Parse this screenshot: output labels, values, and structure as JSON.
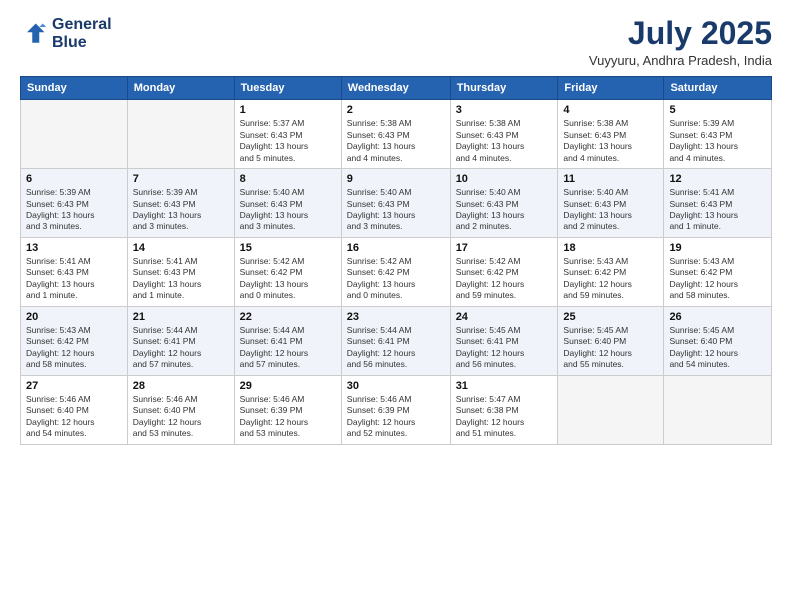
{
  "logo": {
    "line1": "General",
    "line2": "Blue"
  },
  "title": "July 2025",
  "location": "Vuyyuru, Andhra Pradesh, India",
  "weekdays": [
    "Sunday",
    "Monday",
    "Tuesday",
    "Wednesday",
    "Thursday",
    "Friday",
    "Saturday"
  ],
  "weeks": [
    [
      {
        "day": "",
        "info": ""
      },
      {
        "day": "",
        "info": ""
      },
      {
        "day": "1",
        "info": "Sunrise: 5:37 AM\nSunset: 6:43 PM\nDaylight: 13 hours\nand 5 minutes."
      },
      {
        "day": "2",
        "info": "Sunrise: 5:38 AM\nSunset: 6:43 PM\nDaylight: 13 hours\nand 4 minutes."
      },
      {
        "day": "3",
        "info": "Sunrise: 5:38 AM\nSunset: 6:43 PM\nDaylight: 13 hours\nand 4 minutes."
      },
      {
        "day": "4",
        "info": "Sunrise: 5:38 AM\nSunset: 6:43 PM\nDaylight: 13 hours\nand 4 minutes."
      },
      {
        "day": "5",
        "info": "Sunrise: 5:39 AM\nSunset: 6:43 PM\nDaylight: 13 hours\nand 4 minutes."
      }
    ],
    [
      {
        "day": "6",
        "info": "Sunrise: 5:39 AM\nSunset: 6:43 PM\nDaylight: 13 hours\nand 3 minutes."
      },
      {
        "day": "7",
        "info": "Sunrise: 5:39 AM\nSunset: 6:43 PM\nDaylight: 13 hours\nand 3 minutes."
      },
      {
        "day": "8",
        "info": "Sunrise: 5:40 AM\nSunset: 6:43 PM\nDaylight: 13 hours\nand 3 minutes."
      },
      {
        "day": "9",
        "info": "Sunrise: 5:40 AM\nSunset: 6:43 PM\nDaylight: 13 hours\nand 3 minutes."
      },
      {
        "day": "10",
        "info": "Sunrise: 5:40 AM\nSunset: 6:43 PM\nDaylight: 13 hours\nand 2 minutes."
      },
      {
        "day": "11",
        "info": "Sunrise: 5:40 AM\nSunset: 6:43 PM\nDaylight: 13 hours\nand 2 minutes."
      },
      {
        "day": "12",
        "info": "Sunrise: 5:41 AM\nSunset: 6:43 PM\nDaylight: 13 hours\nand 1 minute."
      }
    ],
    [
      {
        "day": "13",
        "info": "Sunrise: 5:41 AM\nSunset: 6:43 PM\nDaylight: 13 hours\nand 1 minute."
      },
      {
        "day": "14",
        "info": "Sunrise: 5:41 AM\nSunset: 6:43 PM\nDaylight: 13 hours\nand 1 minute."
      },
      {
        "day": "15",
        "info": "Sunrise: 5:42 AM\nSunset: 6:42 PM\nDaylight: 13 hours\nand 0 minutes."
      },
      {
        "day": "16",
        "info": "Sunrise: 5:42 AM\nSunset: 6:42 PM\nDaylight: 13 hours\nand 0 minutes."
      },
      {
        "day": "17",
        "info": "Sunrise: 5:42 AM\nSunset: 6:42 PM\nDaylight: 12 hours\nand 59 minutes."
      },
      {
        "day": "18",
        "info": "Sunrise: 5:43 AM\nSunset: 6:42 PM\nDaylight: 12 hours\nand 59 minutes."
      },
      {
        "day": "19",
        "info": "Sunrise: 5:43 AM\nSunset: 6:42 PM\nDaylight: 12 hours\nand 58 minutes."
      }
    ],
    [
      {
        "day": "20",
        "info": "Sunrise: 5:43 AM\nSunset: 6:42 PM\nDaylight: 12 hours\nand 58 minutes."
      },
      {
        "day": "21",
        "info": "Sunrise: 5:44 AM\nSunset: 6:41 PM\nDaylight: 12 hours\nand 57 minutes."
      },
      {
        "day": "22",
        "info": "Sunrise: 5:44 AM\nSunset: 6:41 PM\nDaylight: 12 hours\nand 57 minutes."
      },
      {
        "day": "23",
        "info": "Sunrise: 5:44 AM\nSunset: 6:41 PM\nDaylight: 12 hours\nand 56 minutes."
      },
      {
        "day": "24",
        "info": "Sunrise: 5:45 AM\nSunset: 6:41 PM\nDaylight: 12 hours\nand 56 minutes."
      },
      {
        "day": "25",
        "info": "Sunrise: 5:45 AM\nSunset: 6:40 PM\nDaylight: 12 hours\nand 55 minutes."
      },
      {
        "day": "26",
        "info": "Sunrise: 5:45 AM\nSunset: 6:40 PM\nDaylight: 12 hours\nand 54 minutes."
      }
    ],
    [
      {
        "day": "27",
        "info": "Sunrise: 5:46 AM\nSunset: 6:40 PM\nDaylight: 12 hours\nand 54 minutes."
      },
      {
        "day": "28",
        "info": "Sunrise: 5:46 AM\nSunset: 6:40 PM\nDaylight: 12 hours\nand 53 minutes."
      },
      {
        "day": "29",
        "info": "Sunrise: 5:46 AM\nSunset: 6:39 PM\nDaylight: 12 hours\nand 53 minutes."
      },
      {
        "day": "30",
        "info": "Sunrise: 5:46 AM\nSunset: 6:39 PM\nDaylight: 12 hours\nand 52 minutes."
      },
      {
        "day": "31",
        "info": "Sunrise: 5:47 AM\nSunset: 6:38 PM\nDaylight: 12 hours\nand 51 minutes."
      },
      {
        "day": "",
        "info": ""
      },
      {
        "day": "",
        "info": ""
      }
    ]
  ]
}
